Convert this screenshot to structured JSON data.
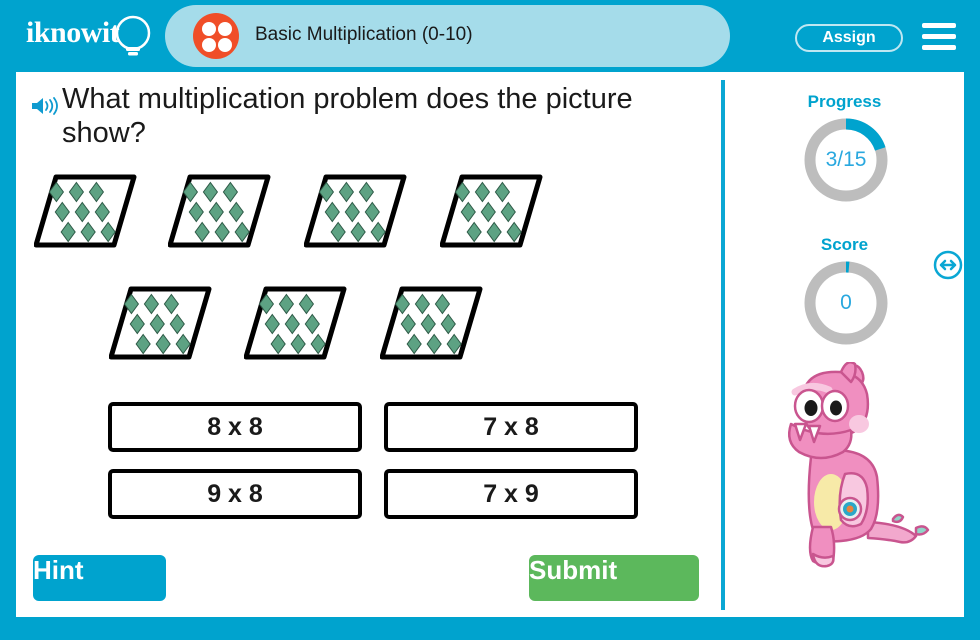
{
  "header": {
    "logo_text": "iknowit",
    "logo_icon": "lightbulb-icon",
    "subject_icon": "four-dots-circle-icon",
    "title": "Basic Multiplication (0-10)",
    "assign_label": "Assign",
    "menu_icon": "hamburger-menu-icon",
    "bar_color": "#00a3ce",
    "title_panel_color": "#a5dcea",
    "dots_circle_color": "#f04e28"
  },
  "question": {
    "audio_icon": "speaker-icon",
    "text": "What multiplication problem does the picture show?"
  },
  "picture": {
    "shape": "parallelogram",
    "group_count": 7,
    "items_per_group": 9,
    "item_shape": "diamond",
    "item_color": "#5da283",
    "outline_color": "#000000",
    "rows": [
      4,
      3
    ]
  },
  "answers": [
    {
      "label": "8 x 8",
      "selected": false
    },
    {
      "label": "7 x 8",
      "selected": false
    },
    {
      "label": "9 x 8",
      "selected": false
    },
    {
      "label": "7 x 9",
      "selected": false
    }
  ],
  "actions": {
    "hint_label": "Hint",
    "hint_color": "#00a3ce",
    "submit_label": "Submit",
    "submit_color": "#5cb85c"
  },
  "sidebar": {
    "progress": {
      "label": "Progress",
      "value": "3/15",
      "completed": 3,
      "total": 15,
      "percent": 20,
      "arc_color": "#00a3ce",
      "track_color": "#bdbdbd"
    },
    "score": {
      "label": "Score",
      "value": "0",
      "percent": 0,
      "arc_color": "#00a3ce",
      "track_color": "#bdbdbd"
    },
    "mascot": "pink-monster-character",
    "resize_icon": "left-right-arrow-icon"
  }
}
